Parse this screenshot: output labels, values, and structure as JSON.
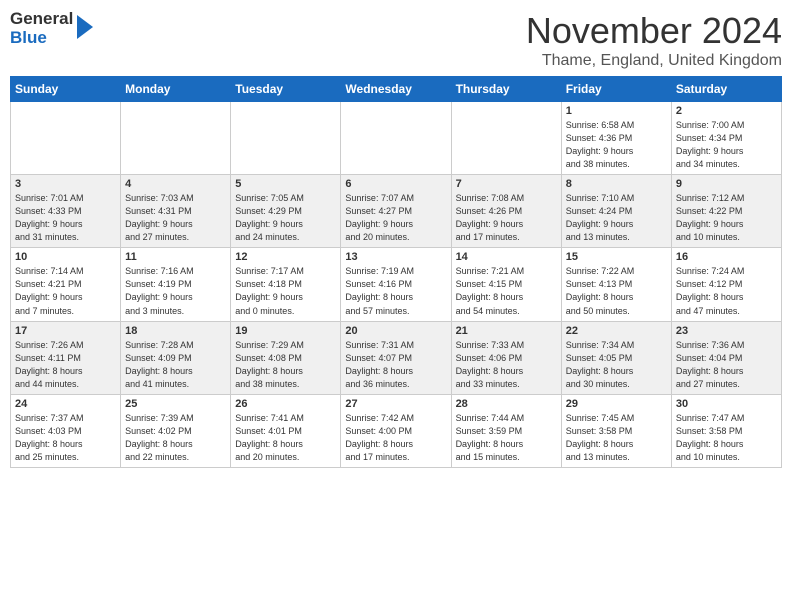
{
  "header": {
    "logo_general": "General",
    "logo_blue": "Blue",
    "month_title": "November 2024",
    "location": "Thame, England, United Kingdom"
  },
  "weekdays": [
    "Sunday",
    "Monday",
    "Tuesday",
    "Wednesday",
    "Thursday",
    "Friday",
    "Saturday"
  ],
  "weeks": [
    [
      {
        "day": "",
        "info": ""
      },
      {
        "day": "",
        "info": ""
      },
      {
        "day": "",
        "info": ""
      },
      {
        "day": "",
        "info": ""
      },
      {
        "day": "",
        "info": ""
      },
      {
        "day": "1",
        "info": "Sunrise: 6:58 AM\nSunset: 4:36 PM\nDaylight: 9 hours\nand 38 minutes."
      },
      {
        "day": "2",
        "info": "Sunrise: 7:00 AM\nSunset: 4:34 PM\nDaylight: 9 hours\nand 34 minutes."
      }
    ],
    [
      {
        "day": "3",
        "info": "Sunrise: 7:01 AM\nSunset: 4:33 PM\nDaylight: 9 hours\nand 31 minutes."
      },
      {
        "day": "4",
        "info": "Sunrise: 7:03 AM\nSunset: 4:31 PM\nDaylight: 9 hours\nand 27 minutes."
      },
      {
        "day": "5",
        "info": "Sunrise: 7:05 AM\nSunset: 4:29 PM\nDaylight: 9 hours\nand 24 minutes."
      },
      {
        "day": "6",
        "info": "Sunrise: 7:07 AM\nSunset: 4:27 PM\nDaylight: 9 hours\nand 20 minutes."
      },
      {
        "day": "7",
        "info": "Sunrise: 7:08 AM\nSunset: 4:26 PM\nDaylight: 9 hours\nand 17 minutes."
      },
      {
        "day": "8",
        "info": "Sunrise: 7:10 AM\nSunset: 4:24 PM\nDaylight: 9 hours\nand 13 minutes."
      },
      {
        "day": "9",
        "info": "Sunrise: 7:12 AM\nSunset: 4:22 PM\nDaylight: 9 hours\nand 10 minutes."
      }
    ],
    [
      {
        "day": "10",
        "info": "Sunrise: 7:14 AM\nSunset: 4:21 PM\nDaylight: 9 hours\nand 7 minutes."
      },
      {
        "day": "11",
        "info": "Sunrise: 7:16 AM\nSunset: 4:19 PM\nDaylight: 9 hours\nand 3 minutes."
      },
      {
        "day": "12",
        "info": "Sunrise: 7:17 AM\nSunset: 4:18 PM\nDaylight: 9 hours\nand 0 minutes."
      },
      {
        "day": "13",
        "info": "Sunrise: 7:19 AM\nSunset: 4:16 PM\nDaylight: 8 hours\nand 57 minutes."
      },
      {
        "day": "14",
        "info": "Sunrise: 7:21 AM\nSunset: 4:15 PM\nDaylight: 8 hours\nand 54 minutes."
      },
      {
        "day": "15",
        "info": "Sunrise: 7:22 AM\nSunset: 4:13 PM\nDaylight: 8 hours\nand 50 minutes."
      },
      {
        "day": "16",
        "info": "Sunrise: 7:24 AM\nSunset: 4:12 PM\nDaylight: 8 hours\nand 47 minutes."
      }
    ],
    [
      {
        "day": "17",
        "info": "Sunrise: 7:26 AM\nSunset: 4:11 PM\nDaylight: 8 hours\nand 44 minutes."
      },
      {
        "day": "18",
        "info": "Sunrise: 7:28 AM\nSunset: 4:09 PM\nDaylight: 8 hours\nand 41 minutes."
      },
      {
        "day": "19",
        "info": "Sunrise: 7:29 AM\nSunset: 4:08 PM\nDaylight: 8 hours\nand 38 minutes."
      },
      {
        "day": "20",
        "info": "Sunrise: 7:31 AM\nSunset: 4:07 PM\nDaylight: 8 hours\nand 36 minutes."
      },
      {
        "day": "21",
        "info": "Sunrise: 7:33 AM\nSunset: 4:06 PM\nDaylight: 8 hours\nand 33 minutes."
      },
      {
        "day": "22",
        "info": "Sunrise: 7:34 AM\nSunset: 4:05 PM\nDaylight: 8 hours\nand 30 minutes."
      },
      {
        "day": "23",
        "info": "Sunrise: 7:36 AM\nSunset: 4:04 PM\nDaylight: 8 hours\nand 27 minutes."
      }
    ],
    [
      {
        "day": "24",
        "info": "Sunrise: 7:37 AM\nSunset: 4:03 PM\nDaylight: 8 hours\nand 25 minutes."
      },
      {
        "day": "25",
        "info": "Sunrise: 7:39 AM\nSunset: 4:02 PM\nDaylight: 8 hours\nand 22 minutes."
      },
      {
        "day": "26",
        "info": "Sunrise: 7:41 AM\nSunset: 4:01 PM\nDaylight: 8 hours\nand 20 minutes."
      },
      {
        "day": "27",
        "info": "Sunrise: 7:42 AM\nSunset: 4:00 PM\nDaylight: 8 hours\nand 17 minutes."
      },
      {
        "day": "28",
        "info": "Sunrise: 7:44 AM\nSunset: 3:59 PM\nDaylight: 8 hours\nand 15 minutes."
      },
      {
        "day": "29",
        "info": "Sunrise: 7:45 AM\nSunset: 3:58 PM\nDaylight: 8 hours\nand 13 minutes."
      },
      {
        "day": "30",
        "info": "Sunrise: 7:47 AM\nSunset: 3:58 PM\nDaylight: 8 hours\nand 10 minutes."
      }
    ]
  ]
}
